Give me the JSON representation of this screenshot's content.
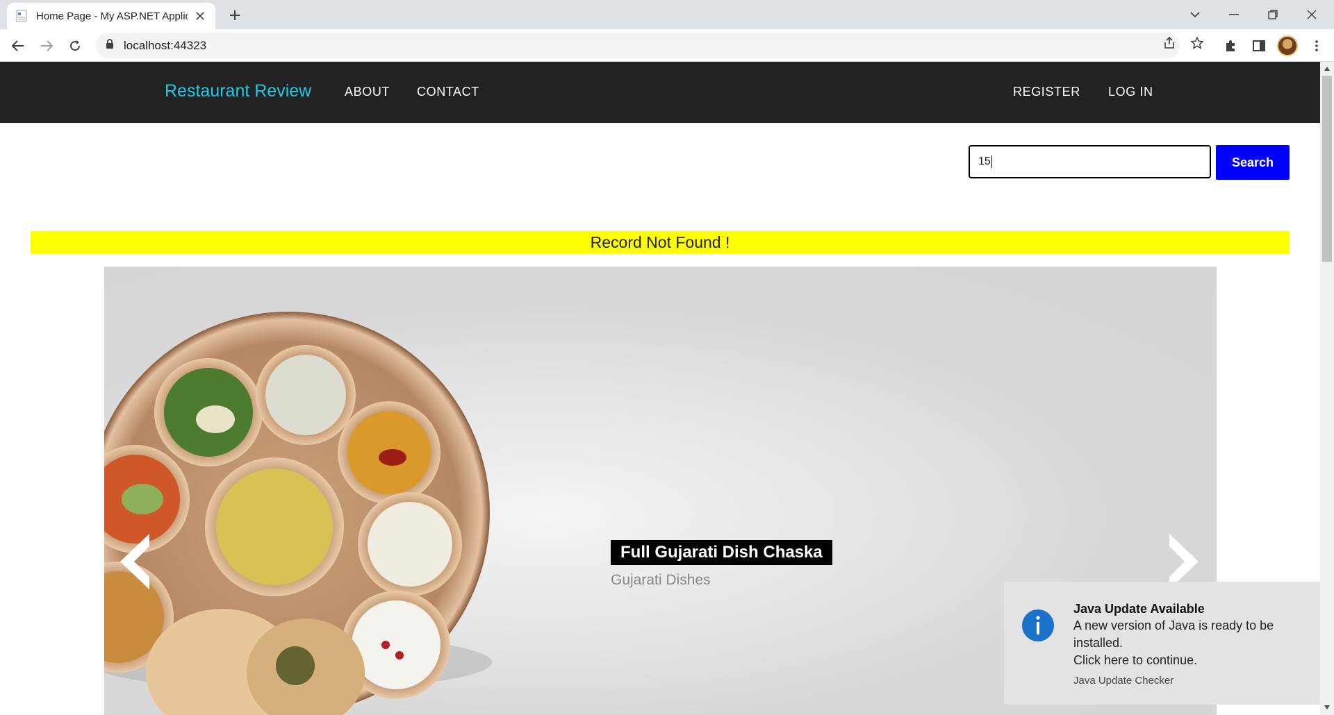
{
  "browser": {
    "tab_title": "Home Page - My ASP.NET Applic",
    "url": "localhost:44323"
  },
  "navbar": {
    "brand": "Restaurant Review",
    "links": [
      "ABOUT",
      "CONTACT"
    ],
    "auth_links": [
      "REGISTER",
      "LOG IN"
    ],
    "brand_color": "#1ec9e6"
  },
  "search": {
    "value": "15",
    "button_label": "Search",
    "button_color": "#0000ff"
  },
  "message": {
    "text": "Record Not Found !",
    "background": "#ffff00"
  },
  "carousel": {
    "caption_title": "Full Gujarati Dish Chaska",
    "caption_subtitle": "Gujarati Dishes",
    "image": "gujarati-thali-plate"
  },
  "toast": {
    "title": "Java Update Available",
    "line1": "A new version of Java is ready to be",
    "line2": "installed.",
    "line3": "Click here to continue.",
    "footer": "Java Update Checker"
  }
}
